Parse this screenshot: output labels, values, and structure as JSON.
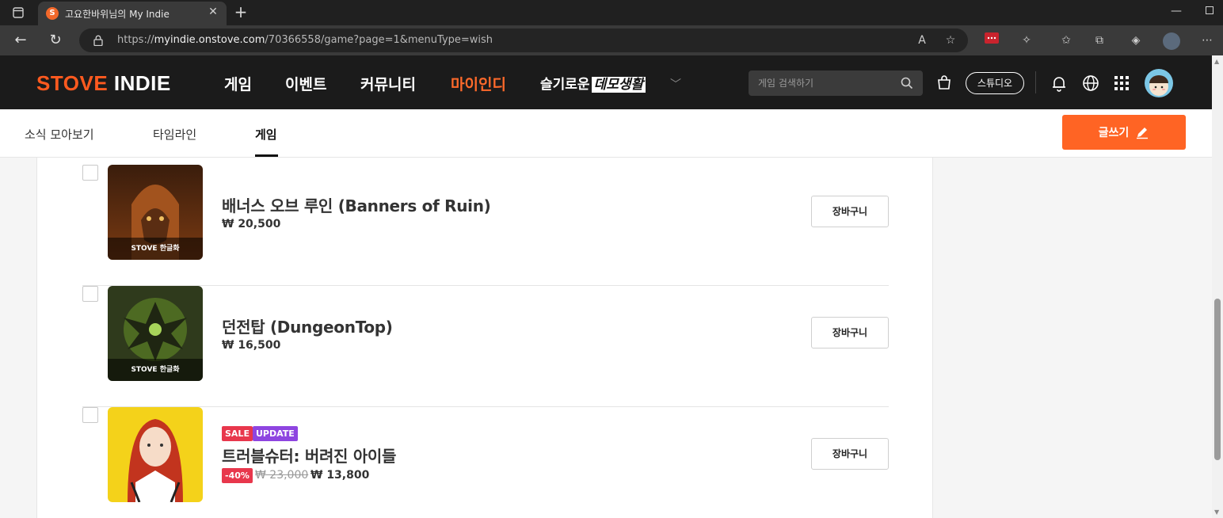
{
  "browser": {
    "tab_title": "고요한바위님의 My Indie",
    "url_prefix": "https://",
    "url_host": "myindie.onstove.com",
    "url_path": "/70366558/game?page=1&menuType=wish"
  },
  "header": {
    "logo_main": "STOVE",
    "logo_sub": " INDIE",
    "nav": [
      {
        "label": "게임",
        "active": false
      },
      {
        "label": "이벤트",
        "active": false
      },
      {
        "label": "커뮤니티",
        "active": false
      },
      {
        "label": "마이인디",
        "active": true
      }
    ],
    "special_prefix": "슬기로운",
    "special_boxed": "데모생활",
    "search_placeholder": "게임 검색하기",
    "studio_label": "스튜디오"
  },
  "subnav": {
    "items": [
      {
        "label": "소식 모아보기",
        "active": false
      },
      {
        "label": "타임라인",
        "active": false
      },
      {
        "label": "게임",
        "active": true
      }
    ],
    "write_label": "글쓰기"
  },
  "games": [
    {
      "title": "배너스 오브 루인 (Banners of Ruin)",
      "price": "₩ 20,500",
      "thumb_badge": "STOVE 한글화",
      "cart_label": "장바구니"
    },
    {
      "title": "던전탑 (DungeonTop)",
      "price": "₩ 16,500",
      "thumb_badge": "STOVE 한글화",
      "cart_label": "장바구니"
    },
    {
      "title": "트러블슈터: 버려진 아이들",
      "tags": [
        "SALE",
        "UPDATE"
      ],
      "discount": "-40%",
      "original_price": "₩ 23,000",
      "sale_price": "₩ 13,800",
      "cart_label": "장바구니"
    }
  ],
  "colors": {
    "brand": "#ff5a1f",
    "write_button": "#ff6424",
    "sale_tag": "#e8374c",
    "update_tag": "#8e45e0"
  }
}
